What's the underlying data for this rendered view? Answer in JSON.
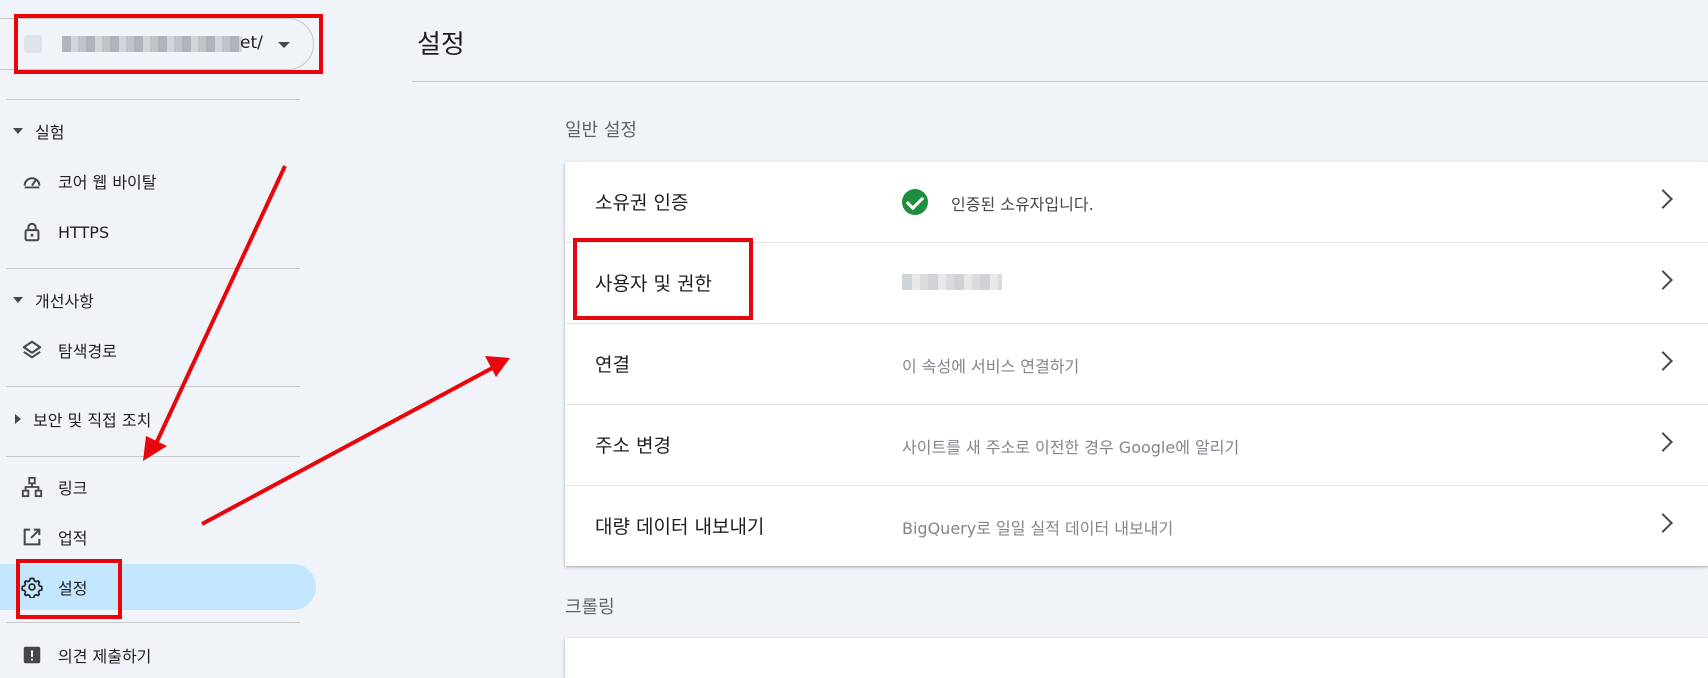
{
  "sidebar": {
    "property": {
      "suffix": "et/"
    },
    "sections": {
      "experience": "실험",
      "enhancements": "개선사항",
      "security": "보안 및 직접 조치"
    },
    "items": {
      "core_web_vitals": "코어 웹 바이탈",
      "https": "HTTPS",
      "breadcrumbs": "탐색경로",
      "links": "링크",
      "achievements": "업적",
      "settings": "설정",
      "feedback": "의견 제출하기"
    }
  },
  "main": {
    "title": "설정",
    "general_label": "일반 설정",
    "rows": [
      {
        "label": "소유권 인증",
        "value": "인증된 소유자입니다."
      },
      {
        "label": "사용자 및 권한",
        "value": ""
      },
      {
        "label": "연결",
        "value": "이 속성에 서비스 연결하기"
      },
      {
        "label": "주소 변경",
        "value": "사이트를 새 주소로 이전한 경우 Google에 알리기"
      },
      {
        "label": "대량 데이터 내보내기",
        "value": "BigQuery로 일일 실적 데이터 내보내기"
      }
    ],
    "crawling_label": "크롤링"
  },
  "annotation_color": "#e8060c"
}
